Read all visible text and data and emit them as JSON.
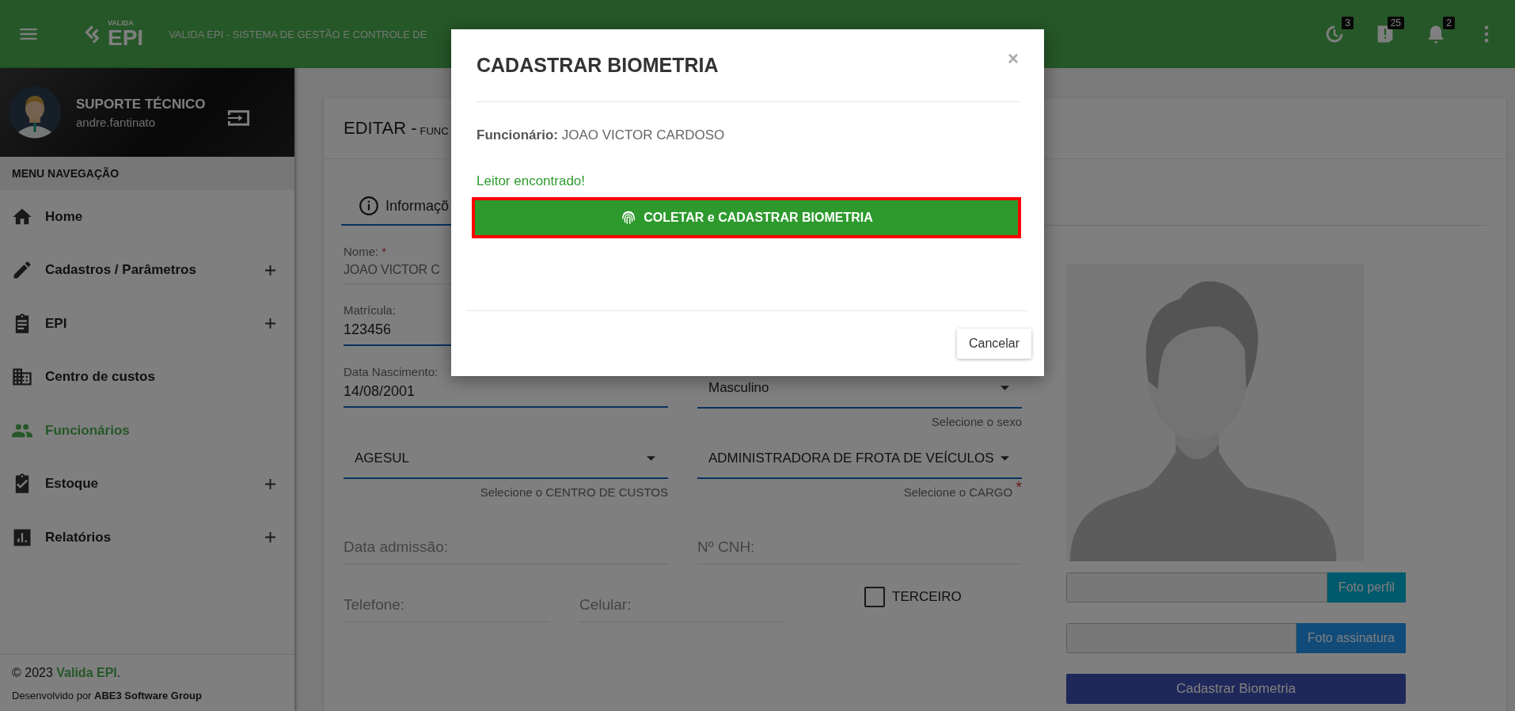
{
  "topbar": {
    "logo_small": "VALIDA",
    "logo_main": "EPI",
    "title": "VALIDA EPI - SISTEMA DE GESTÃO E CONTROLE DE",
    "indicators": [
      {
        "kind": "history",
        "count": "3"
      },
      {
        "kind": "alert",
        "count": "25"
      },
      {
        "kind": "bell",
        "count": "2"
      }
    ]
  },
  "user": {
    "name": "SUPORTE TÉCNICO",
    "username": "andre.fantinato"
  },
  "sidebar": {
    "heading": "MENU NAVEGAÇÃO",
    "items": [
      {
        "label": "Home",
        "expandable": false,
        "selected": false
      },
      {
        "label": "Cadastros / Parâmetros",
        "expandable": true,
        "selected": false
      },
      {
        "label": "EPI",
        "expandable": true,
        "selected": false
      },
      {
        "label": "Centro de custos",
        "expandable": false,
        "selected": false
      },
      {
        "label": "Funcionários",
        "expandable": false,
        "selected": true
      },
      {
        "label": "Estoque",
        "expandable": true,
        "selected": false
      },
      {
        "label": "Relatórios",
        "expandable": true,
        "selected": false
      }
    ],
    "footer": {
      "year": "© 2023",
      "brand": "Valida EPI",
      "suffix": ".",
      "credit": "Desenvolvido por **ABE3 Software Group**"
    }
  },
  "card": {
    "title": "EDITAR -",
    "subtitle": "FUNC",
    "tabs": [
      {
        "label": "Informaçõ",
        "selected": true
      }
    ]
  },
  "form": {
    "required_symbol": "*",
    "name": {
      "label": "Nome:",
      "required": true,
      "value": "JOAO VICTOR C"
    },
    "registration": {
      "label": "Matrícula:",
      "value": "123456"
    },
    "birth": {
      "label": "Data Nascimento:",
      "value": "14/08/2001"
    },
    "sex": {
      "value": "Masculino",
      "hint": "Selecione o sexo"
    },
    "cost_center": {
      "value": "AGESUL",
      "hint": "Selecione o CENTRO DE CUSTOS"
    },
    "role": {
      "value": "ADMINISTRADORA DE FROTA DE VEÍCULOS",
      "hint": "Selecione o CARGO",
      "required": true
    },
    "admission": {
      "placeholder": "Data admissão:"
    },
    "cnh": {
      "placeholder": "Nº CNH:"
    },
    "phone": {
      "placeholder": "Telefone:"
    },
    "mobile": {
      "placeholder": "Celular:"
    },
    "third_party": {
      "label": "TERCEIRO",
      "checked": false
    }
  },
  "photo": {
    "profile_button": "Foto perfil",
    "signature_button": "Foto assinatura",
    "biometry_button": "Cadastrar Biometria"
  },
  "modal": {
    "title": "CADASTRAR BIOMETRIA",
    "close": "×",
    "employee_label": "Funcionário:",
    "employee": "JOAO VICTOR CARDOSO",
    "status": "Leitor encontrado!",
    "action": "COLETAR e CADASTRAR BIOMETRIA",
    "highlighted": true,
    "cancel": "Cancelar"
  }
}
